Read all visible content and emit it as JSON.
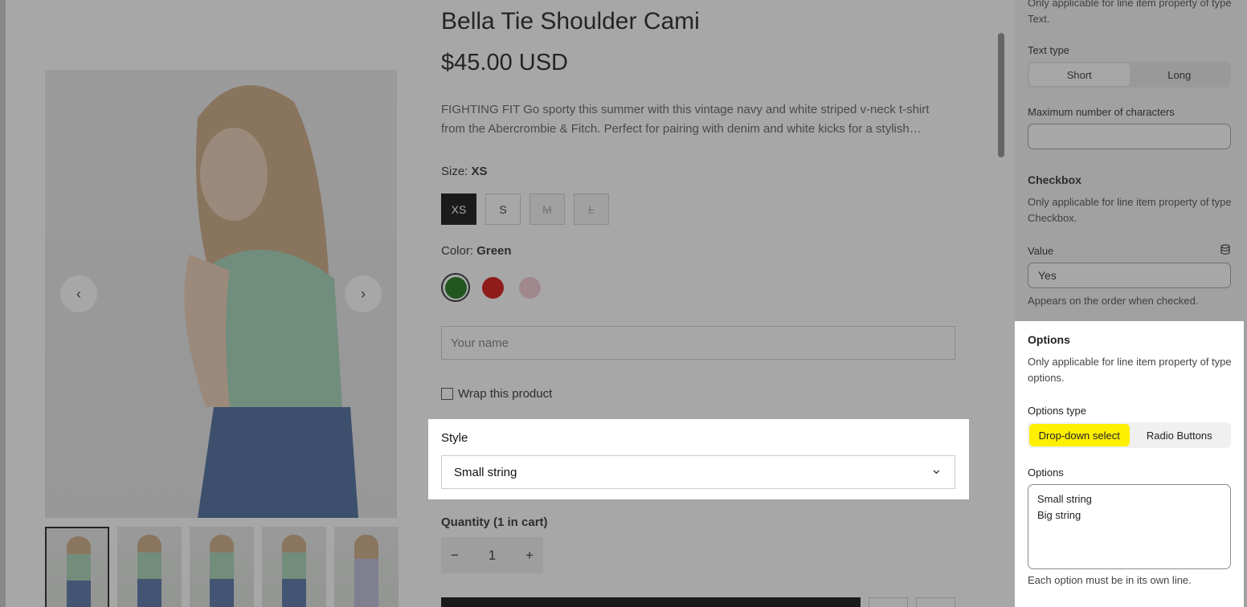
{
  "product": {
    "title": "Bella Tie Shoulder Cami",
    "price": "$45.00 USD",
    "description": "FIGHTING FIT Go sporty this summer with this vintage navy and white striped v-neck t-shirt from the Abercrombie & Fitch. Perfect for pairing with denim and white kicks for a stylish…",
    "size_label": "Size:",
    "size_value": "XS",
    "sizes": [
      "XS",
      "S",
      "M",
      "L"
    ],
    "color_label": "Color:",
    "color_value": "Green",
    "colors": [
      "#0a6e0a",
      "#d40000",
      "#f2c7d0"
    ],
    "name_placeholder": "Your name",
    "wrap_label": "Wrap this product",
    "style_label": "Style",
    "style_value": "Small string",
    "quantity_label": "Quantity (1 in cart)",
    "quantity_value": "1",
    "quantity_minus": "−",
    "quantity_plus": "+",
    "prev_arrow": "‹",
    "next_arrow": "›",
    "chevron": "⌄"
  },
  "panel": {
    "text_note": "Only applicable for line item property of type Text.",
    "text_type_label": "Text type",
    "text_type_options": [
      "Short",
      "Long"
    ],
    "max_chars_label": "Maximum number of characters",
    "checkbox_heading": "Checkbox",
    "checkbox_note": "Only applicable for line item property of type Checkbox.",
    "value_label": "Value",
    "value": "Yes",
    "value_help": "Appears on the order when checked.",
    "options_heading": "Options",
    "options_note": "Only applicable for line item property of type options.",
    "options_type_label": "Options type",
    "options_type_choices": [
      "Drop-down select",
      "Radio Buttons"
    ],
    "options_label": "Options",
    "options_value": "Small string\nBig string",
    "options_help": "Each option must be in its own line."
  }
}
